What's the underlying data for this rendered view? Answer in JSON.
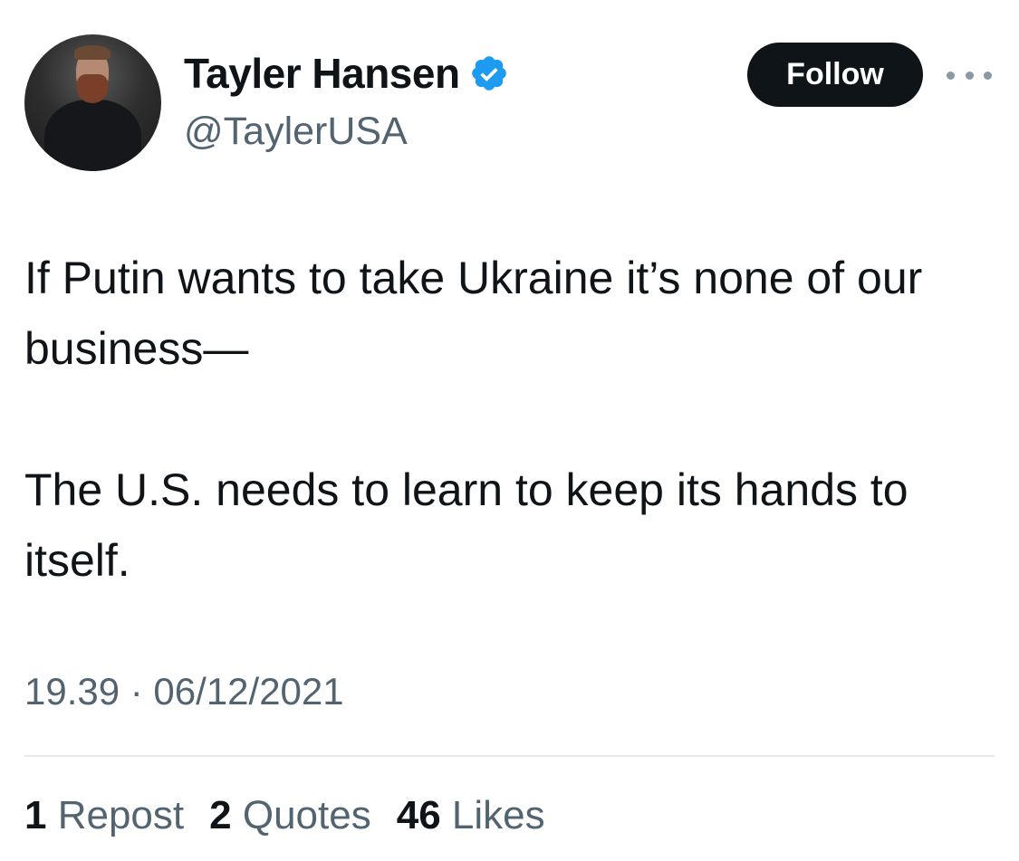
{
  "author": {
    "display_name": "Tayler Hansen",
    "handle": "@TaylerUSA",
    "verified_icon": "verified-badge-icon",
    "verified_color": "#1d9bf0"
  },
  "actions": {
    "follow_label": "Follow",
    "more_icon": "more-options-icon"
  },
  "tweet": {
    "paragraphs": [
      "If Putin wants to take Ukraine it’s none of our business—",
      "The U.S. needs to learn to keep its hands to itself."
    ],
    "timestamp": "19.39 · 06/12/2021"
  },
  "stats": {
    "reposts": {
      "count": "1",
      "label": "Repost"
    },
    "quotes": {
      "count": "2",
      "label": "Quotes"
    },
    "likes": {
      "count": "46",
      "label": "Likes"
    }
  },
  "colors": {
    "text_primary": "#0f1419",
    "text_secondary": "#536471",
    "button_bg": "#0f1419",
    "divider": "#e6e9eb"
  }
}
